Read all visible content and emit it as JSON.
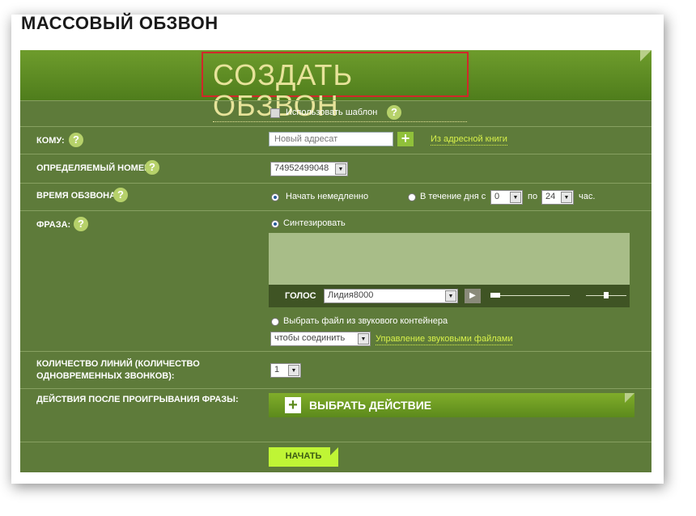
{
  "page_title": "МАССОВЫЙ ОБЗВОН",
  "header": {
    "title": "СОЗДАТЬ ОБЗВОН"
  },
  "template": {
    "label": "Использовать шаблон"
  },
  "help_glyph": "?",
  "to": {
    "label": "КОМУ:",
    "placeholder": "Новый адресат",
    "plus": "+",
    "address_book_link": "Из адресной книги"
  },
  "caller_id": {
    "label": "ОПРЕДЕЛЯЕМЫЙ НОМЕР",
    "value": "74952499048"
  },
  "call_time": {
    "label": "ВРЕМЯ ОБЗВОНА",
    "start_now": "Начать немедленно",
    "during_day_from": "В течение дня с",
    "from_value": "0",
    "to_label": "по",
    "to_value": "24",
    "hours_label": "час."
  },
  "phrase": {
    "label": "ФРАЗА:",
    "synthesize": "Синтезировать",
    "voice_label": "ГОЛОС",
    "voice_value": "Лидия8000",
    "choose_file": "Выбрать файл из звукового контейнера",
    "file_value": "чтобы соединить",
    "manage_link": "Управление звуковыми файлами"
  },
  "lines": {
    "label_line1": "КОЛИЧЕСТВО ЛИНИЙ (КОЛИЧЕСТВО",
    "label_line2": "ОДНОВРЕМЕННЫХ ЗВОНКОВ):",
    "value": "1"
  },
  "actions": {
    "label": "ДЕЙСТВИЯ ПОСЛЕ ПРОИГРЫВАНИЯ ФРАЗЫ:",
    "button": "ВЫБРАТЬ ДЕЙСТВИЕ",
    "plus": "+"
  },
  "start": {
    "button": "НАЧАТЬ"
  },
  "colors": {
    "panel": "#5e7b3a",
    "accent": "#bff535",
    "link": "#d7f04a",
    "highlight_border": "#d0282a"
  }
}
